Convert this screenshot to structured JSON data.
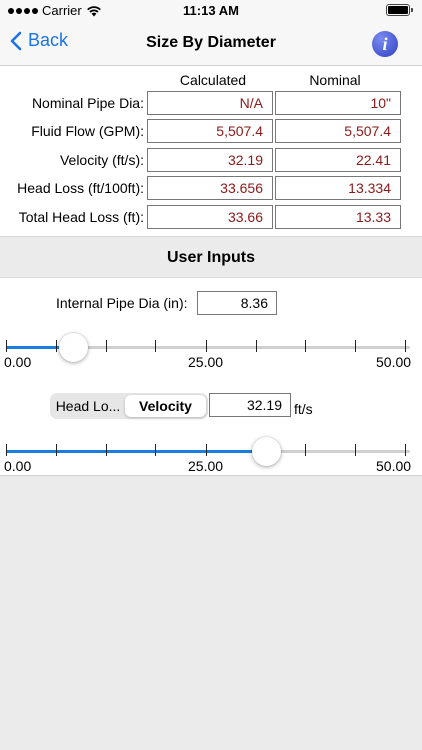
{
  "status": {
    "carrier": "Carrier",
    "time": "11:13 AM"
  },
  "nav": {
    "back": "Back",
    "title": "Size By Diameter",
    "info": "i"
  },
  "table": {
    "headers": {
      "calculated": "Calculated",
      "nominal": "Nominal"
    },
    "rows": [
      {
        "label": "Nominal Pipe Dia:",
        "calculated": "N/A",
        "nominal": "10\""
      },
      {
        "label": "Fluid Flow (GPM):",
        "calculated": "5,507.4",
        "nominal": "5,507.4"
      },
      {
        "label": "Velocity (ft/s):",
        "calculated": "32.19",
        "nominal": "22.41"
      },
      {
        "label": "Head Loss (ft/100ft):",
        "calculated": "33.656",
        "nominal": "13.334"
      },
      {
        "label": "Total Head Loss (ft):",
        "calculated": "33.66",
        "nominal": "13.33"
      }
    ]
  },
  "user_inputs": {
    "title": "User Inputs",
    "pipe_dia": {
      "label": "Internal Pipe Dia (in):",
      "value": "8.36"
    },
    "slider1": {
      "min_label": "0.00",
      "mid_label": "25.00",
      "max_label": "50.00",
      "min": 0,
      "max": 50,
      "value": 8.36
    },
    "mode": {
      "left": "Head Lo...",
      "right": "Velocity",
      "selected": "Velocity"
    },
    "velocity": {
      "value": "32.19",
      "unit": "ft/s"
    },
    "slider2": {
      "min_label": "0.00",
      "mid_label": "25.00",
      "max_label": "50.00",
      "min": 0,
      "max": 50,
      "value": 32.19
    }
  },
  "colors": {
    "accent": "#1a7de0",
    "value_text": "#8b1a1a"
  }
}
